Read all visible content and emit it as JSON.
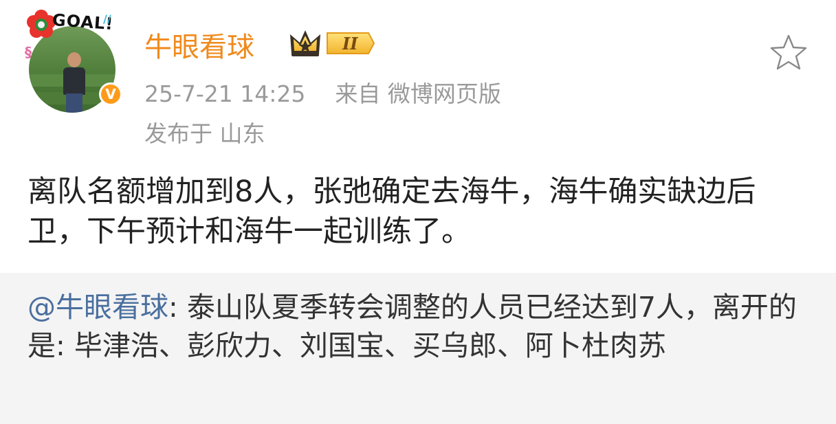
{
  "author": {
    "name": "牛眼看球",
    "avatar_text": "GOAL!",
    "level_badge": "II"
  },
  "meta": {
    "timestamp": "25-7-21 14:25",
    "source": "来自 微博网页版",
    "location": "发布于 山东"
  },
  "post": {
    "text": "离队名额增加到8人，张弛确定去海牛，海牛确实缺边后卫，下午预计和海牛一起训练了。"
  },
  "repost": {
    "mention": "@牛眼看球",
    "text": ": 泰山队夏季转会调整的人员已经达到7人，离开的是: 毕津浩、彭欣力、刘国宝、买乌郎、阿卜杜肉苏"
  },
  "colors": {
    "username": "#f08a1c",
    "mention": "#4a6f9e",
    "meta": "#9a9a9a",
    "repost_bg": "#f4f4f4",
    "verified": "#ff9b1a"
  },
  "icons": {
    "favorite": "star-outline-icon",
    "verified": "verified-v-icon",
    "badge": "crown-badge-icon"
  }
}
